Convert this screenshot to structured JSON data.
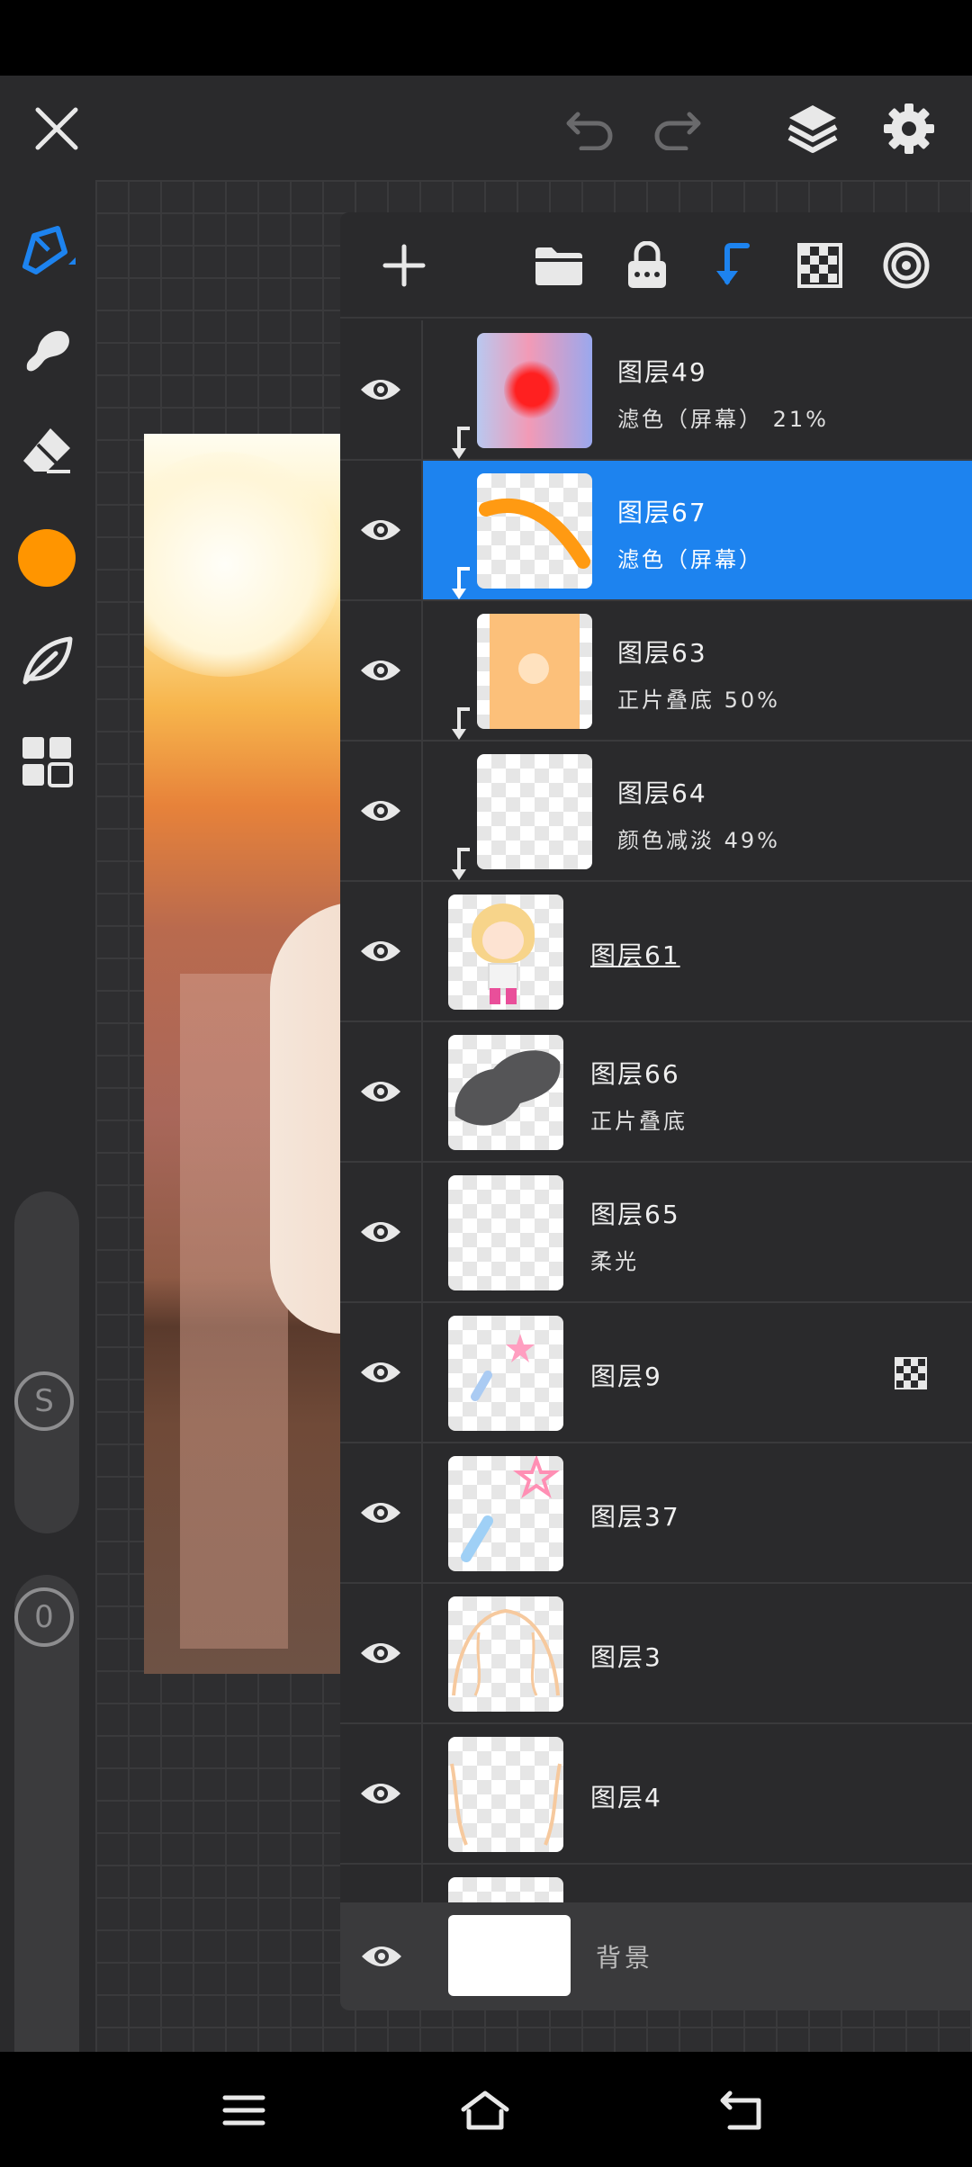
{
  "app": {
    "accent_color": "#1d83ef",
    "brush_color": "#ff9500"
  },
  "topbar": {
    "icons": [
      "close-icon",
      "undo-icon",
      "redo-icon",
      "layers-icon",
      "gear-icon"
    ]
  },
  "toolrail": {
    "tools": [
      "pen-tool-icon",
      "smudge-tool-icon",
      "eraser-tool-icon",
      "color-swatch",
      "leaf-tool-icon",
      "panels-icon"
    ],
    "size_slider_label": "S",
    "opacity_slider_label": "0"
  },
  "layers_panel": {
    "toolbar_icons": [
      "add-layer-icon",
      "folder-icon",
      "lock-icon",
      "clipping-icon",
      "alpha-lock-icon",
      "target-icon"
    ],
    "layers": [
      {
        "name": "图层49",
        "mode": "滤色（屏幕） 21%",
        "clipped": true,
        "selected": false
      },
      {
        "name": "图层67",
        "mode": "滤色（屏幕）",
        "clipped": true,
        "selected": true
      },
      {
        "name": "图层63",
        "mode": "正片叠底 50%",
        "clipped": true,
        "selected": false
      },
      {
        "name": "图层64",
        "mode": "颜色减淡 49%",
        "clipped": true,
        "selected": false
      },
      {
        "name": "图层61",
        "mode": "",
        "clipped": false,
        "selected": false
      },
      {
        "name": "图层66",
        "mode": "正片叠底",
        "clipped": false,
        "selected": false
      },
      {
        "name": "图层65",
        "mode": "柔光",
        "clipped": false,
        "selected": false
      },
      {
        "name": "图层9",
        "mode": "",
        "clipped": false,
        "selected": false,
        "alpha_locked": true
      },
      {
        "name": "图层37",
        "mode": "",
        "clipped": false,
        "selected": false
      },
      {
        "name": "图层3",
        "mode": "",
        "clipped": false,
        "selected": false
      },
      {
        "name": "图层4",
        "mode": "",
        "clipped": false,
        "selected": false
      }
    ],
    "background_layer_name": "背景"
  },
  "navbar": {
    "icons": [
      "menu-icon",
      "home-icon",
      "back-icon"
    ]
  }
}
